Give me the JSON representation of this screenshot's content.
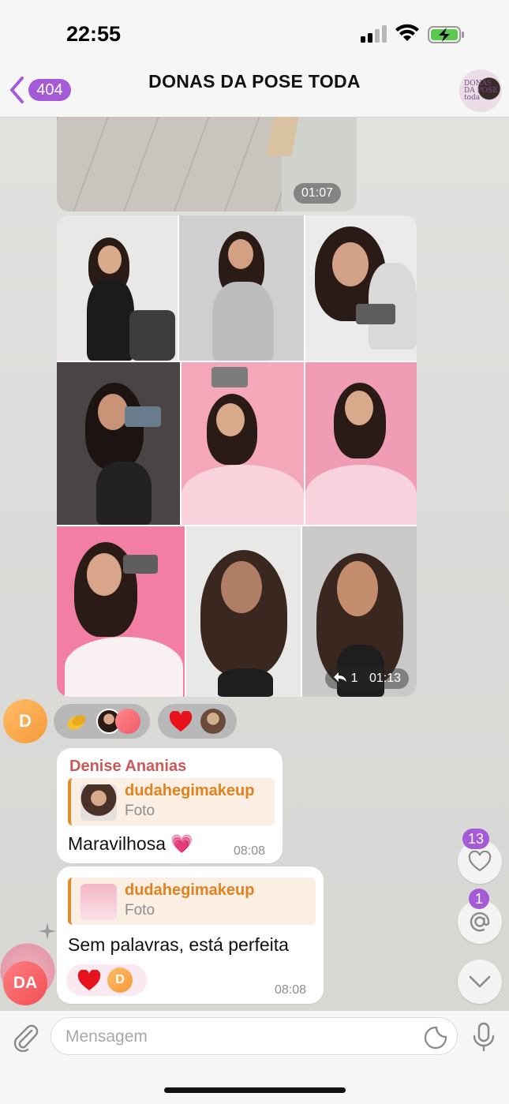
{
  "status_bar": {
    "time": "22:55"
  },
  "header": {
    "back_count": "404",
    "title": "DONAS DA POSE TODA",
    "avatar_text": "DONAS DA POSE toda"
  },
  "media": {
    "video_duration": "01:07",
    "album_forward_count": "1",
    "album_time": "01:13"
  },
  "reactions_row": {
    "avatar_initial": "D"
  },
  "messages": [
    {
      "sender": "Denise Ananias",
      "reply_name": "dudahegimakeup",
      "reply_type": "Foto",
      "text": "Maravilhosa 💗",
      "time": "08:08"
    },
    {
      "reply_name": "dudahegimakeup",
      "reply_type": "Foto",
      "text": "Sem palavras, está perfeita",
      "reaction_avatar": "D",
      "time": "08:08"
    }
  ],
  "side_buttons": {
    "reactions_count": "13",
    "mentions_count": "1"
  },
  "sender_avatar": "DA",
  "input": {
    "placeholder": "Mensagem"
  },
  "colors": {
    "accent": "#a55ad8",
    "reply_bar": "#e08a2c",
    "sender_name": "#c95a57"
  }
}
